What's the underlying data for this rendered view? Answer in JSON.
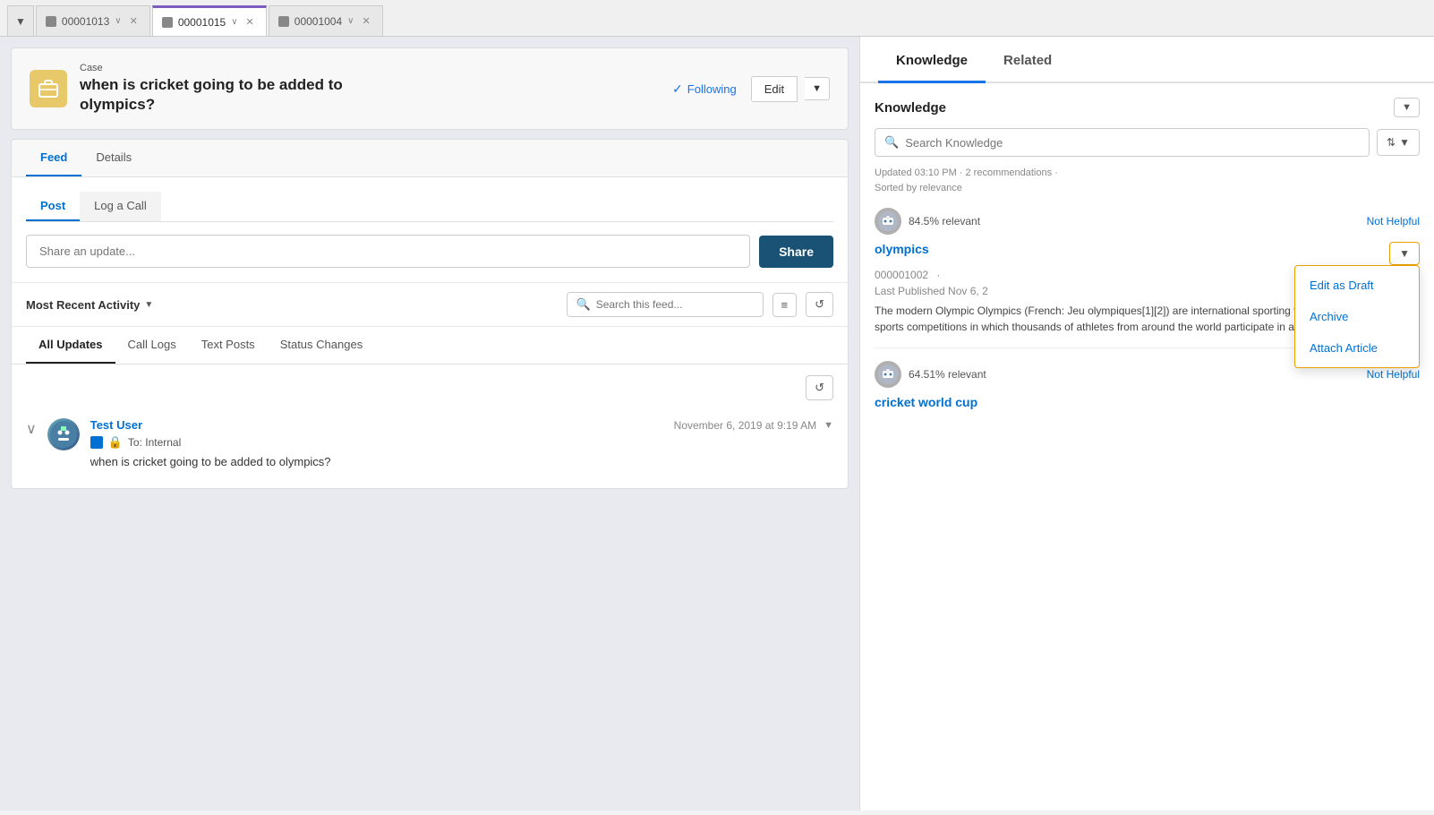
{
  "browser": {
    "dropdown_label": "▼",
    "tabs": [
      {
        "id": "tab-00001013",
        "label": "00001013",
        "active": false,
        "icon": "case-icon"
      },
      {
        "id": "tab-00001015",
        "label": "00001015",
        "active": true,
        "icon": "case-icon"
      },
      {
        "id": "tab-00001004",
        "label": "00001004",
        "active": false,
        "icon": "case-icon"
      }
    ]
  },
  "case": {
    "label": "Case",
    "title_line1": "when is cricket going to be added to",
    "title_line2": "olympics?",
    "following_label": "Following",
    "edit_label": "Edit"
  },
  "content_tabs": [
    {
      "label": "Feed",
      "active": true
    },
    {
      "label": "Details",
      "active": false
    }
  ],
  "post": {
    "tab_post": "Post",
    "tab_log": "Log a Call",
    "input_placeholder": "Share an update...",
    "share_label": "Share"
  },
  "feed": {
    "activity_label": "Most Recent Activity",
    "search_placeholder": "Search this feed...",
    "filter_icon_label": "≡",
    "refresh_icon_label": "↺",
    "filter_tabs": [
      {
        "label": "All Updates",
        "active": true
      },
      {
        "label": "Call Logs",
        "active": false
      },
      {
        "label": "Text Posts",
        "active": false
      },
      {
        "label": "Status Changes",
        "active": false
      }
    ],
    "item": {
      "user_name": "Test User",
      "timestamp": "November 6, 2019 at 9:19 AM",
      "to_label": "To: Internal",
      "message": "when is cricket going to be added to olympics?"
    }
  },
  "right_panel": {
    "tabs": [
      {
        "label": "Knowledge",
        "active": true
      },
      {
        "label": "Related",
        "active": false
      }
    ],
    "knowledge": {
      "section_title": "Knowledge",
      "search_placeholder": "Search Knowledge",
      "meta_updated": "Updated 03:10 PM · 2 recommendations ·",
      "meta_sorted": "Sorted by relevance",
      "item1": {
        "relevance": "84.5% relevant",
        "not_helpful": "Not Helpful",
        "article_title": "olympics",
        "article_id": "000001002",
        "last_published": "Last Published  Nov 6, 2",
        "excerpt": "The modern Olympic Olympics (French: Jeu olympiques[1][2]) are international sporting featuring summer and... sports competitions in which thousands of athletes from around the world participate in a variety of competitions.",
        "dropdown_options": [
          "Edit as Draft",
          "Archive",
          "Attach Article"
        ]
      },
      "item2": {
        "relevance": "64.51% relevant",
        "not_helpful": "Not Helpful",
        "article_title": "cricket world cup"
      }
    }
  }
}
